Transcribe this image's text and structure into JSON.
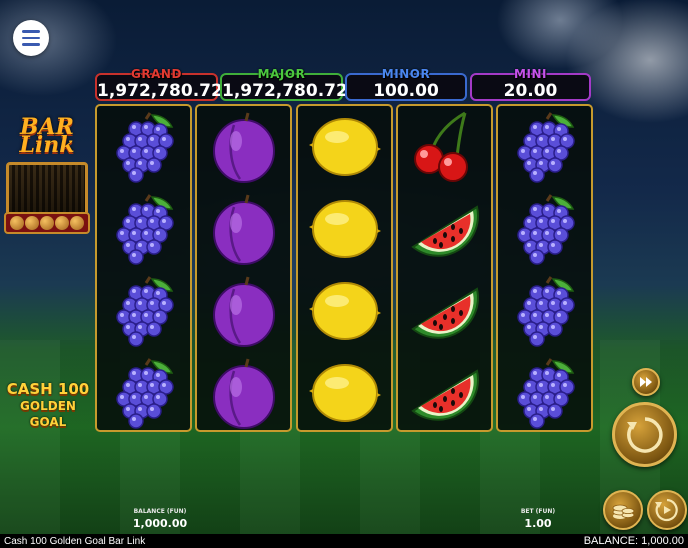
{
  "game": {
    "title": "Cash 100 Golden Goal Bar Link",
    "status_balance": "BALANCE: 1,000.00"
  },
  "jackpots": [
    {
      "label": "GRAND",
      "value": "1,972,780.72",
      "color": "#e23a32"
    },
    {
      "label": "MAJOR",
      "value": "1,972,780.72",
      "color": "#4cc83f"
    },
    {
      "label": "MINOR",
      "value": "100.00",
      "color": "#4a86ee"
    },
    {
      "label": "MINI",
      "value": "20.00",
      "color": "#c553ea"
    }
  ],
  "reels": [
    [
      "grapes",
      "grapes",
      "grapes",
      "grapes"
    ],
    [
      "plum",
      "plum",
      "plum",
      "plum"
    ],
    [
      "lemon",
      "lemon",
      "lemon",
      "lemon"
    ],
    [
      "cherry",
      "watermelon",
      "watermelon",
      "watermelon"
    ],
    [
      "grapes",
      "grapes",
      "grapes",
      "grapes"
    ]
  ],
  "logos": {
    "bar_link": "BAR Link",
    "cash_line1": "CASH 100",
    "cash_line2": "GOLDEN GOAL"
  },
  "footer": {
    "balance_label": "BALANCE (FUN)",
    "balance_value": "1,000.00",
    "bet_label": "BET (FUN)",
    "bet_value": "1.00"
  },
  "icons": {
    "menu": "hamburger-icon",
    "turbo": "fast-forward-icon",
    "spin": "spin-arrow-icon",
    "bet": "coin-stack-icon",
    "auto": "autoplay-icon"
  },
  "colors": {
    "reel_border": "#c69a2d",
    "button_gold": "#d6a23a"
  }
}
